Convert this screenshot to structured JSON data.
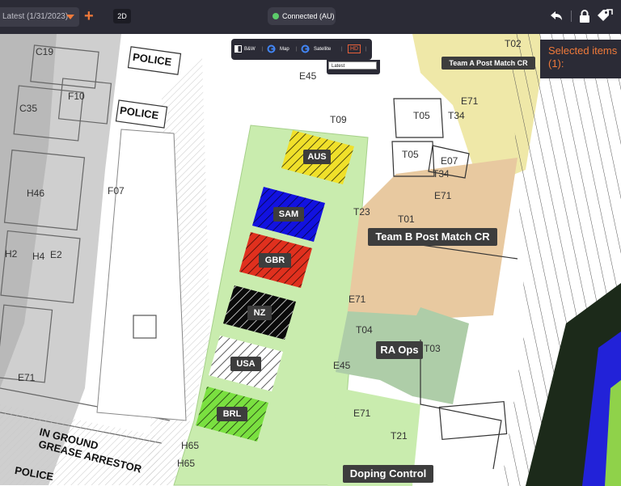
{
  "topbar": {
    "version_label": "Latest (1/31/2023)",
    "add_label": "+",
    "view_mode": "2D",
    "status": "Connected (AU)"
  },
  "layers": {
    "bw": "B&W",
    "map": "Map",
    "satellite": "Satellite",
    "hd": "HD",
    "version_option": "Latest"
  },
  "selection": {
    "title": "Selected items",
    "count": "(1):"
  },
  "zones": {
    "aus": "AUS",
    "sam": "SAM",
    "gbr": "GBR",
    "nz": "NZ",
    "usa": "USA",
    "brl": "BRL",
    "team_a": "Team A Post Match CR",
    "team_b": "Team B Post Match CR",
    "ra_ops": "RA Ops",
    "doping": "Doping Control"
  },
  "rooms": {
    "police1": "POLICE",
    "police2": "POLICE",
    "police3": "POLICE",
    "c19": "C19",
    "c35": "C35",
    "f10": "F10",
    "f07": "F07",
    "h46": "H46",
    "h2": "H2",
    "h4": "H4",
    "e2": "E2",
    "e71a": "E71",
    "e71b": "E71",
    "e71c": "E71",
    "e71d": "E71",
    "e71e": "E71",
    "e45a": "E45",
    "e45b": "E45",
    "t02": "T02",
    "t05a": "T05",
    "t05b": "T05",
    "t34a": "T34",
    "t34b": "T34",
    "e07": "E07",
    "t09": "T09",
    "t23": "T23",
    "t01": "T01",
    "t04": "T04",
    "t03": "T03",
    "t21": "T21",
    "h65a": "H65",
    "h65b": "H65",
    "grease1": "IN GROUND",
    "grease2": "GREASE ARRESTOR"
  },
  "colors": {
    "topbar": "#2b2b36",
    "accent": "#f07a3a",
    "connected": "#5ccc6a",
    "aus": "#f0e02a",
    "sam": "#1212e0",
    "gbr": "#e0301e",
    "nz": "#0a0a0a",
    "usa": "#ffffff",
    "brl": "#7ae040",
    "green_zone": "#c9ecae",
    "team_a": "#efe8a8",
    "team_b": "#e8c9a0",
    "ra_ops": "#aecda8"
  },
  "icons": [
    "chevron-down-icon",
    "plus-icon",
    "status-dot-icon",
    "undo-icon",
    "lock-icon",
    "tags-icon",
    "google-icon"
  ]
}
